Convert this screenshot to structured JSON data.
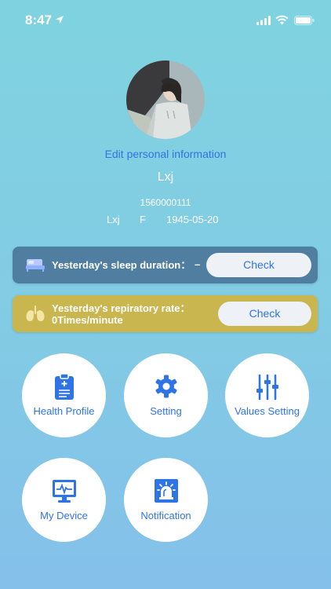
{
  "status_bar": {
    "time": "8:47"
  },
  "profile": {
    "edit_label": "Edit personal information",
    "nickname": "Lxj",
    "phone": "1560000111",
    "name": "Lxj",
    "gender": "F",
    "birthdate": "1945-05-20"
  },
  "sleep_card": {
    "label": "Yesterday's sleep duration：",
    "value": "–",
    "button_label": "Check"
  },
  "resp_card": {
    "label": "Yesterday's repiratory rate：0Times/minute",
    "button_label": "Check"
  },
  "tiles": [
    {
      "label": "Health Profile",
      "icon": "clipboard-icon"
    },
    {
      "label": "Setting",
      "icon": "gear-icon"
    },
    {
      "label": "Values Setting",
      "icon": "sliders-icon"
    },
    {
      "label": "My Device",
      "icon": "monitor-icon"
    },
    {
      "label": "Notification",
      "icon": "siren-icon"
    }
  ],
  "colors": {
    "accent": "#2f74e6",
    "sleep_card": "#4f7ea0",
    "resp_card": "#c9b64e",
    "background_top": "#7fd3e0",
    "background_bottom": "#84c0ea"
  }
}
